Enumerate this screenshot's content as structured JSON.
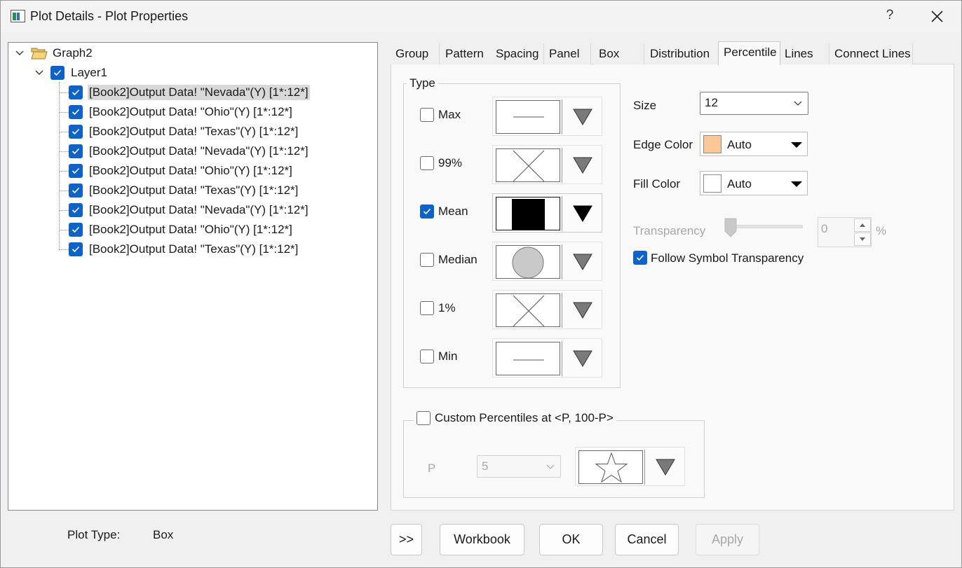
{
  "window": {
    "title": "Plot Details - Plot Properties",
    "help": "?"
  },
  "tree": {
    "root": "Graph2",
    "layer": "Layer1",
    "items": [
      {
        "label": "[Book2]Output Data! \"Nevada\"(Y) [1*:12*]",
        "checked": true,
        "selected": true
      },
      {
        "label": "[Book2]Output Data! \"Ohio\"(Y) [1*:12*]",
        "checked": true
      },
      {
        "label": "[Book2]Output Data! \"Texas\"(Y) [1*:12*]",
        "checked": true
      },
      {
        "label": "[Book2]Output Data! \"Nevada\"(Y) [1*:12*]",
        "checked": true
      },
      {
        "label": "[Book2]Output Data! \"Ohio\"(Y) [1*:12*]",
        "checked": true
      },
      {
        "label": "[Book2]Output Data! \"Texas\"(Y) [1*:12*]",
        "checked": true
      },
      {
        "label": "[Book2]Output Data! \"Nevada\"(Y) [1*:12*]",
        "checked": true
      },
      {
        "label": "[Book2]Output Data! \"Ohio\"(Y) [1*:12*]",
        "checked": true
      },
      {
        "label": "[Book2]Output Data! \"Texas\"(Y) [1*:12*]",
        "checked": true
      }
    ]
  },
  "plot_type": {
    "label": "Plot Type:",
    "value": "Box"
  },
  "tabs": [
    "Group",
    "Pattern",
    "Spacing",
    "Panel",
    "Box",
    "Distribution",
    "Percentile",
    "Lines",
    "Connect Lines"
  ],
  "active_tab": "Percentile",
  "type_group": {
    "title": "Type",
    "rows": [
      {
        "label": "Max",
        "checked": false,
        "symbol": "dash-line"
      },
      {
        "label": "99%",
        "checked": false,
        "symbol": "x-cross"
      },
      {
        "label": "Mean",
        "checked": true,
        "symbol": "filled-square"
      },
      {
        "label": "Median",
        "checked": false,
        "symbol": "circle"
      },
      {
        "label": "1%",
        "checked": false,
        "symbol": "x-cross"
      },
      {
        "label": "Min",
        "checked": false,
        "symbol": "dash-line"
      }
    ]
  },
  "size": {
    "label": "Size",
    "value": "12"
  },
  "edge_color": {
    "label": "Edge Color",
    "value": "Auto",
    "swatch": "#fdc898"
  },
  "fill_color": {
    "label": "Fill Color",
    "value": "Auto",
    "swatch": "#ffffff"
  },
  "transparency": {
    "label": "Transparency",
    "value": "0",
    "unit": "%"
  },
  "follow_symbol": {
    "label": "Follow Symbol Transparency",
    "checked": true
  },
  "custom": {
    "label": "Custom Percentiles at <P, 100-P>",
    "checked": false,
    "p_label": "P",
    "p_value": "5",
    "symbol": "star"
  },
  "buttons": {
    "expand": ">>",
    "workbook": "Workbook",
    "ok": "OK",
    "cancel": "Cancel",
    "apply": "Apply"
  }
}
